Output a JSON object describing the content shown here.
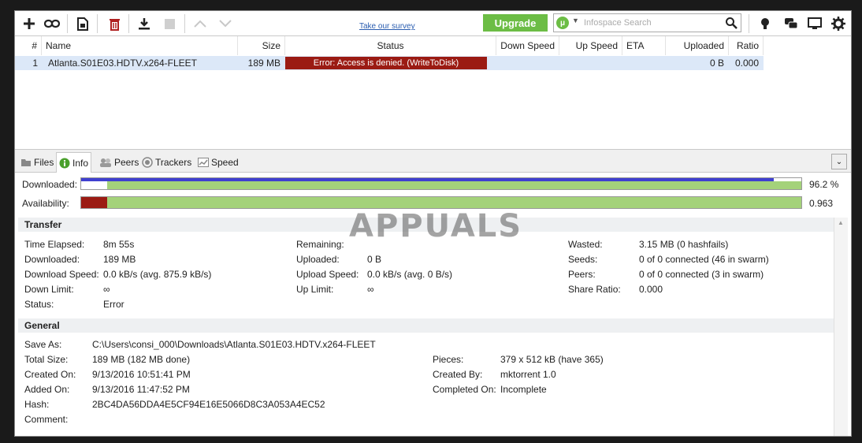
{
  "toolbar": {
    "survey_label": "Take our survey",
    "upgrade_label": "Upgrade",
    "search_placeholder": "Infospace Search"
  },
  "columns": [
    "#",
    "Name",
    "Size",
    "Status",
    "Down Speed",
    "Up Speed",
    "ETA",
    "Uploaded",
    "Ratio"
  ],
  "torrents": [
    {
      "num": "1",
      "name": "Atlanta.S01E03.HDTV.x264-FLEET",
      "size": "189 MB",
      "status": "Error: Access is denied.  (WriteToDisk)",
      "down_speed": "",
      "up_speed": "",
      "eta": "",
      "uploaded": "0 B",
      "ratio": "0.000"
    }
  ],
  "tabs": [
    "Files",
    "Info",
    "Peers",
    "Trackers",
    "Speed"
  ],
  "active_tab": "Info",
  "progress": {
    "downloaded_label": "Downloaded:",
    "downloaded_value": "96.2 %",
    "downloaded_fraction": 0.962,
    "availability_label": "Availability:",
    "availability_value": "0.963",
    "availability_fraction": 0.963
  },
  "watermark": "APPUALS",
  "transfer": {
    "title": "Transfer",
    "col1": [
      {
        "k": "Time Elapsed:",
        "v": "8m 55s"
      },
      {
        "k": "Downloaded:",
        "v": "189 MB"
      },
      {
        "k": "Download Speed:",
        "v": "0.0 kB/s (avg. 875.9 kB/s)"
      },
      {
        "k": "Down Limit:",
        "v": "∞"
      },
      {
        "k": "Status:",
        "v": "Error"
      }
    ],
    "col2": [
      {
        "k": "Remaining:",
        "v": ""
      },
      {
        "k": "Uploaded:",
        "v": "0 B"
      },
      {
        "k": "Upload Speed:",
        "v": "0.0 kB/s (avg. 0 B/s)"
      },
      {
        "k": "Up Limit:",
        "v": "∞"
      }
    ],
    "col3": [
      {
        "k": "Wasted:",
        "v": "3.15 MB (0 hashfails)"
      },
      {
        "k": "Seeds:",
        "v": "0 of 0 connected (46 in swarm)"
      },
      {
        "k": "Peers:",
        "v": "0 of 0 connected (3 in swarm)"
      },
      {
        "k": "Share Ratio:",
        "v": "0.000"
      }
    ]
  },
  "general": {
    "title": "General",
    "save_as_label": "Save As:",
    "save_as": "C:\\Users\\consi_000\\Downloads\\Atlanta.S01E03.HDTV.x264-FLEET",
    "col1": [
      {
        "k": "Total Size:",
        "v": "189 MB (182 MB done)"
      },
      {
        "k": "Created On:",
        "v": "9/13/2016 10:51:41 PM"
      },
      {
        "k": "Added On:",
        "v": "9/13/2016 11:47:52 PM"
      },
      {
        "k": "Hash:",
        "v": "2BC4DA56DDA4E5CF94E16E5066D8C3A053A4EC52"
      },
      {
        "k": "Comment:",
        "v": ""
      }
    ],
    "col2": [
      {
        "k": "Pieces:",
        "v": "379 x 512 kB (have 365)"
      },
      {
        "k": "Created By:",
        "v": "mktorrent 1.0"
      },
      {
        "k": "Completed On:",
        "v": "Incomplete"
      }
    ]
  },
  "colors": {
    "accent_green": "#6cbd45",
    "error_red": "#9b1b13",
    "progress_blue": "#4040d0",
    "progress_green": "#a4d27a"
  }
}
